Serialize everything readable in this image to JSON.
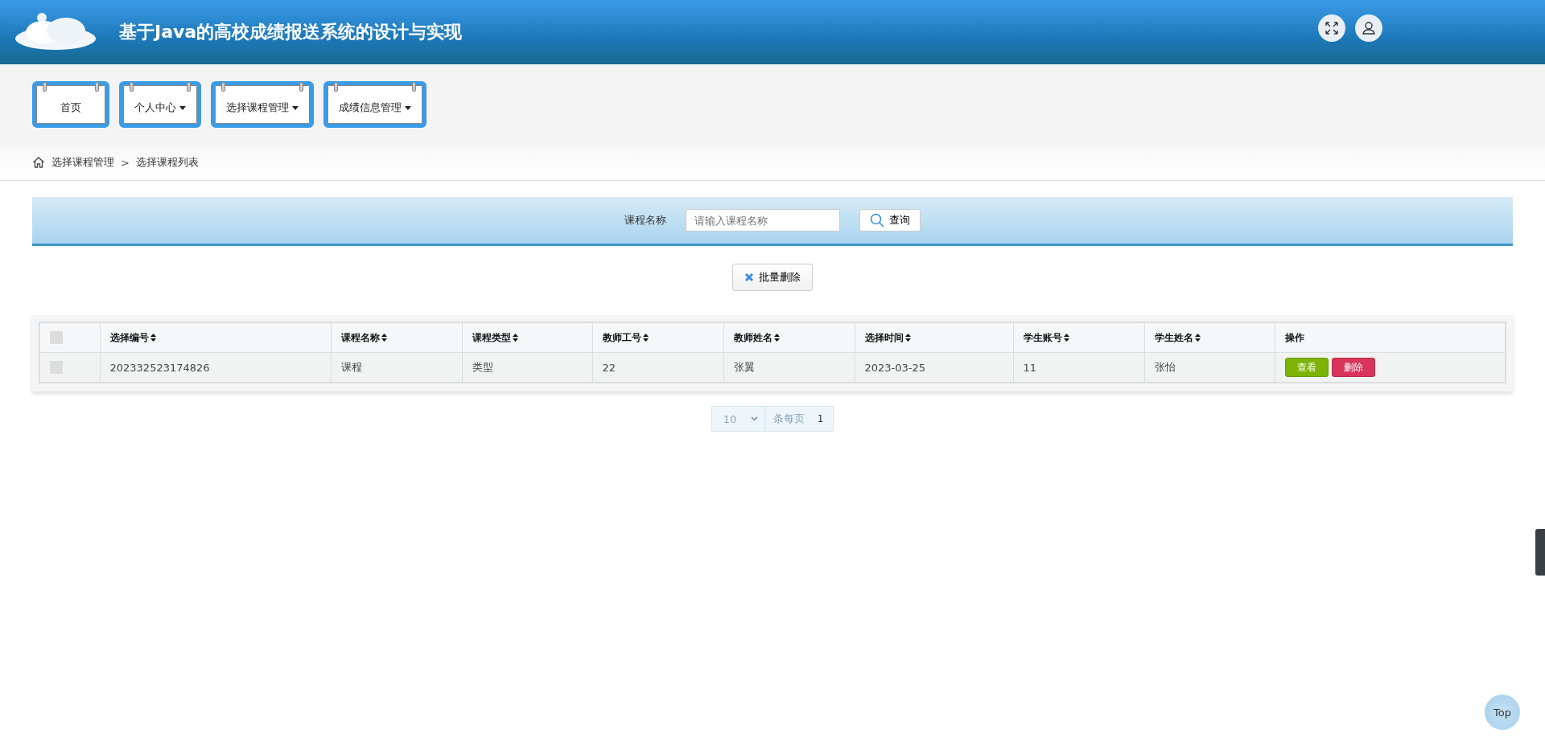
{
  "header": {
    "title": "基于Java的高校成绩报送系统的设计与实现"
  },
  "nav": [
    {
      "label": "首页",
      "dropdown": false
    },
    {
      "label": "个人中心",
      "dropdown": true
    },
    {
      "label": "选择课程管理",
      "dropdown": true
    },
    {
      "label": "成绩信息管理",
      "dropdown": true
    }
  ],
  "breadcrumb": {
    "items": [
      "选择课程管理",
      "选择课程列表"
    ],
    "separator": ">"
  },
  "search": {
    "label": "课程名称",
    "placeholder": "请输入课程名称",
    "button": "查询"
  },
  "batch_delete": "批量删除",
  "table": {
    "select_all_checked": false,
    "columns": [
      {
        "label": "选择编号",
        "sortable": true
      },
      {
        "label": "课程名称",
        "sortable": true
      },
      {
        "label": "课程类型",
        "sortable": true
      },
      {
        "label": "教师工号",
        "sortable": true
      },
      {
        "label": "教师姓名",
        "sortable": true
      },
      {
        "label": "选择时间",
        "sortable": true
      },
      {
        "label": "学生账号",
        "sortable": true
      },
      {
        "label": "学生姓名",
        "sortable": true
      },
      {
        "label": "操作",
        "sortable": false
      }
    ],
    "rows": [
      {
        "checked": false,
        "cells": [
          "202332523174826",
          "课程",
          "类型",
          "22",
          "张翼",
          "2023-03-25",
          "11",
          "张怡"
        ],
        "actions": [
          {
            "label": "查看",
            "kind": "view"
          },
          {
            "label": "删除",
            "kind": "delete"
          }
        ]
      }
    ]
  },
  "pagination": {
    "page_size": "10",
    "per_page_label": "条每页",
    "page": "1"
  },
  "top_button": "Top"
}
